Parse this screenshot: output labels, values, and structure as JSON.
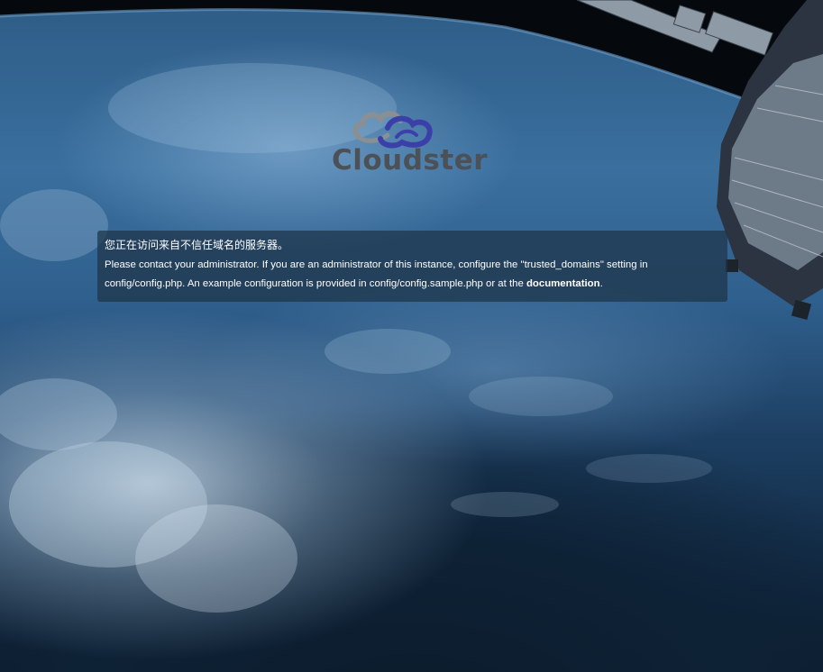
{
  "logo": {
    "text": "Cloudster",
    "icon": "cloud-icon"
  },
  "error": {
    "title": "您正在访问来自不信任域名的服务器。",
    "body_before_link": "Please contact your administrator. If you are an administrator of this instance, configure the \"trusted_domains\" setting in config/config.php. An example configuration is provided in config/config.sample.php or at the ",
    "link_label": "documentation",
    "body_after_link": "."
  },
  "colors": {
    "logo_text": "#4b5157",
    "logo_cloud_gray": "#8a8f93",
    "logo_cloud_blue": "#3b3fa8",
    "panel_bg": "rgba(30,52,72,0.72)",
    "text": "#ffffff"
  }
}
